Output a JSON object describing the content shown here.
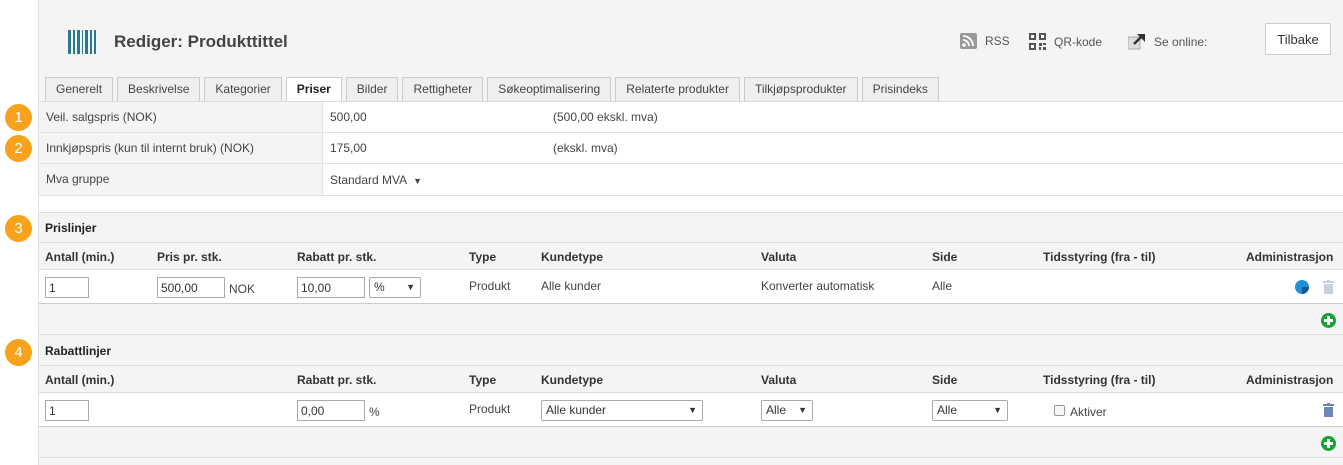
{
  "header": {
    "title": "Rediger: Produkttittel",
    "rss_label": "RSS",
    "qr_label": "QR-kode",
    "online_label": "Se online:",
    "back_label": "Tilbake"
  },
  "tabs": [
    {
      "label": "Generelt",
      "active": false
    },
    {
      "label": "Beskrivelse",
      "active": false
    },
    {
      "label": "Kategorier",
      "active": false
    },
    {
      "label": "Priser",
      "active": true
    },
    {
      "label": "Bilder",
      "active": false
    },
    {
      "label": "Rettigheter",
      "active": false
    },
    {
      "label": "Søkeoptimalisering",
      "active": false
    },
    {
      "label": "Relaterte produkter",
      "active": false
    },
    {
      "label": "Tilkjøpsprodukter",
      "active": false
    },
    {
      "label": "Prisindeks",
      "active": false
    }
  ],
  "badges": [
    "1",
    "2",
    "3",
    "4"
  ],
  "pricing": {
    "retail_label": "Veil. salgspris (NOK)",
    "retail_value": "500,00",
    "retail_note": "(500,00 ekskl. mva)",
    "cost_label": "Innkjøpspris (kun til internt bruk) (NOK)",
    "cost_value": "175,00",
    "cost_note": "(ekskl. mva)",
    "vat_label": "Mva gruppe",
    "vat_value": "Standard MVA"
  },
  "price_lines": {
    "title": "Prislinjer",
    "columns": {
      "qty": "Antall (min.)",
      "price": "Pris pr. stk.",
      "discount": "Rabatt pr. stk.",
      "type": "Type",
      "customer": "Kundetype",
      "currency": "Valuta",
      "site": "Side",
      "timing": "Tidsstyring (fra - til)",
      "admin": "Administrasjon"
    },
    "row": {
      "qty": "1",
      "price": "500,00",
      "price_unit": "NOK",
      "discount": "10,00",
      "discount_unit": "%",
      "type": "Produkt",
      "customer": "Alle kunder",
      "currency": "Konverter automatisk",
      "site": "Alle"
    }
  },
  "discount_lines": {
    "title": "Rabattlinjer",
    "columns": {
      "qty": "Antall (min.)",
      "discount": "Rabatt pr. stk.",
      "type": "Type",
      "customer": "Kundetype",
      "currency": "Valuta",
      "site": "Side",
      "timing": "Tidsstyring (fra - til)",
      "admin": "Administrasjon"
    },
    "row": {
      "qty": "1",
      "discount": "0,00",
      "discount_unit": "%",
      "type": "Produkt",
      "customer": "Alle kunder",
      "currency": "Alle",
      "site": "Alle",
      "activate_label": "Aktiver"
    }
  },
  "colors": {
    "badge": "#f7a21b",
    "add": "#1aa135",
    "edit": "#1f8fd8",
    "trash": "#8ea2c6"
  }
}
